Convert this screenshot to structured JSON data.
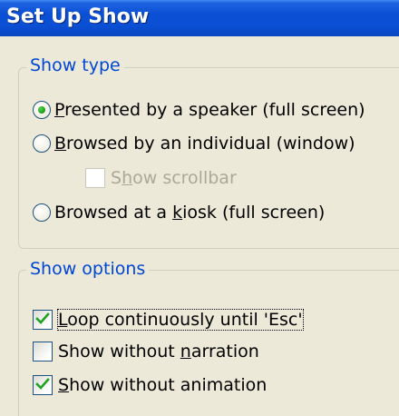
{
  "dialog": {
    "title": "Set Up Show"
  },
  "show_type": {
    "label": "Show type",
    "options": [
      {
        "pre": "",
        "accel": "P",
        "post": "resented by a speaker (full screen)",
        "selected": true
      },
      {
        "pre": "",
        "accel": "B",
        "post": "rowsed by an individual (window)",
        "selected": false
      },
      {
        "pre": "Browsed at a ",
        "accel": "k",
        "post": "iosk (full screen)",
        "selected": false
      }
    ],
    "scrollbar": {
      "pre": "S",
      "accel": "h",
      "post": "ow scrollbar",
      "checked": false,
      "enabled": false
    }
  },
  "show_options": {
    "label": "Show options",
    "items": [
      {
        "pre": "",
        "accel": "L",
        "post": "oop continuously until 'Esc'",
        "checked": true,
        "focused": true
      },
      {
        "pre": "Show without ",
        "accel": "n",
        "post": "arration",
        "checked": false
      },
      {
        "pre": "",
        "accel": "S",
        "post": "how without animation",
        "checked": true
      }
    ]
  },
  "colors": {
    "title_bar": "#0a4fd4",
    "group_label": "#0046d5",
    "check_green": "#21a121",
    "dialog_bg": "#ece9d8"
  }
}
